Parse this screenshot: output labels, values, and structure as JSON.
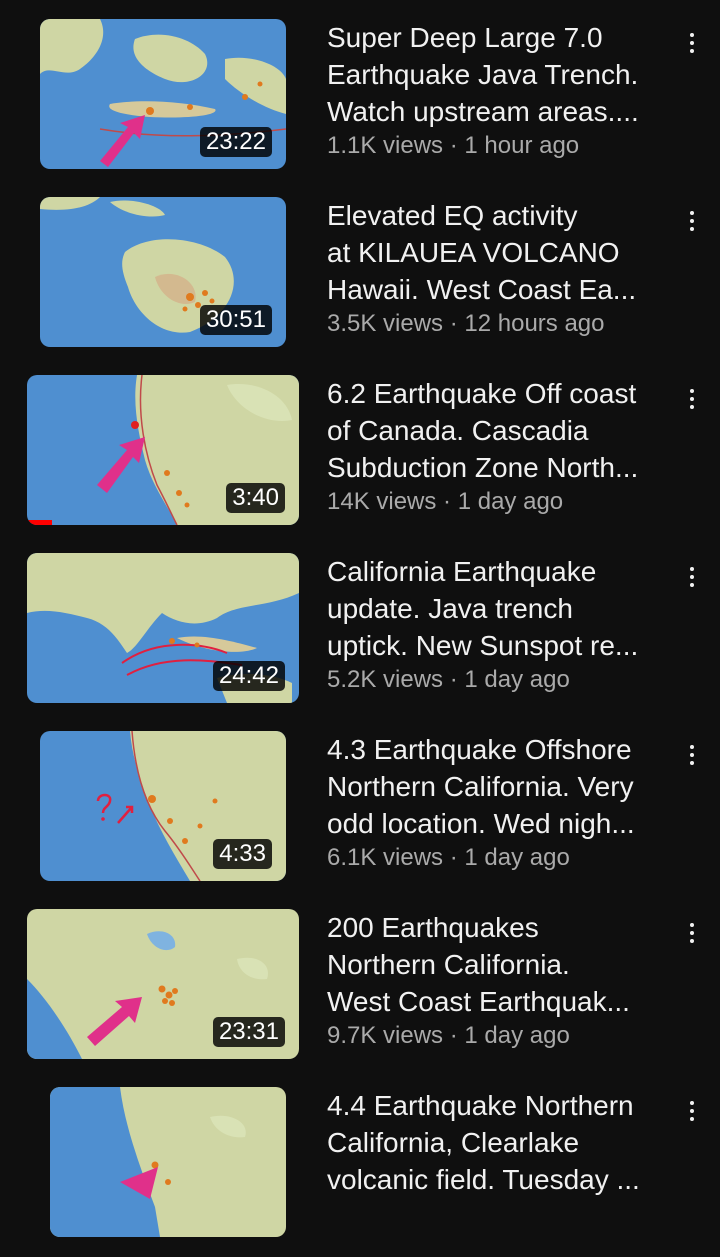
{
  "feed": {
    "videos": [
      {
        "title": "Super Deep Large 7.0\nEarthquake Java Trench.\nWatch upstream areas....",
        "duration": "23:22",
        "views": "1.1K views",
        "age": "1 hour ago",
        "watched_fraction": 0,
        "thumbnail": "map-indonesia-java-arrow"
      },
      {
        "title": "Elevated EQ activity\nat KILAUEA VOLCANO\nHawaii. West Coast Ea...",
        "duration": "30:51",
        "views": "3.5K views",
        "age": "12 hours ago",
        "watched_fraction": 0,
        "thumbnail": "map-hawaii-big-island"
      },
      {
        "title": "6.2 Earthquake Off coast\nof Canada. Cascadia\nSubduction Zone North...",
        "duration": "3:40",
        "views": "14K views",
        "age": "1 day ago",
        "watched_fraction": 0.09,
        "thumbnail": "map-north-america-west-arrow"
      },
      {
        "title": "California Earthquake\nupdate. Java trench\nuptick. New Sunspot re...",
        "duration": "24:42",
        "views": "5.2K views",
        "age": "1 day ago",
        "watched_fraction": 0,
        "thumbnail": "map-indian-ocean-arrows"
      },
      {
        "title": "4.3 Earthquake Offshore\nNorthern California. Very\nodd location. Wed nigh...",
        "duration": "4:33",
        "views": "6.1K views",
        "age": "1 day ago",
        "watched_fraction": 0,
        "thumbnail": "map-california-offshore"
      },
      {
        "title": "200 Earthquakes\nNorthern California.\nWest Coast Earthquak...",
        "duration": "23:31",
        "views": "9.7K views",
        "age": "1 day ago",
        "watched_fraction": 0,
        "thumbnail": "map-northern-california-arrow"
      },
      {
        "title": "4.4 Earthquake Northern\nCalifornia, Clearlake\nvolcanic field. Tuesday ...",
        "duration": "",
        "views": "",
        "age": "",
        "watched_fraction": 0,
        "thumbnail": "map-california-coast"
      }
    ]
  },
  "colors": {
    "background": "#0f0f0f",
    "title_text": "#f1f1f1",
    "meta_text": "#aaaaaa",
    "progress": "#ff0000",
    "ocean": "#4f8fd0",
    "land": "#cfd6a4",
    "arrow": "#e0308a",
    "quake_dot": "#e07a1e"
  }
}
